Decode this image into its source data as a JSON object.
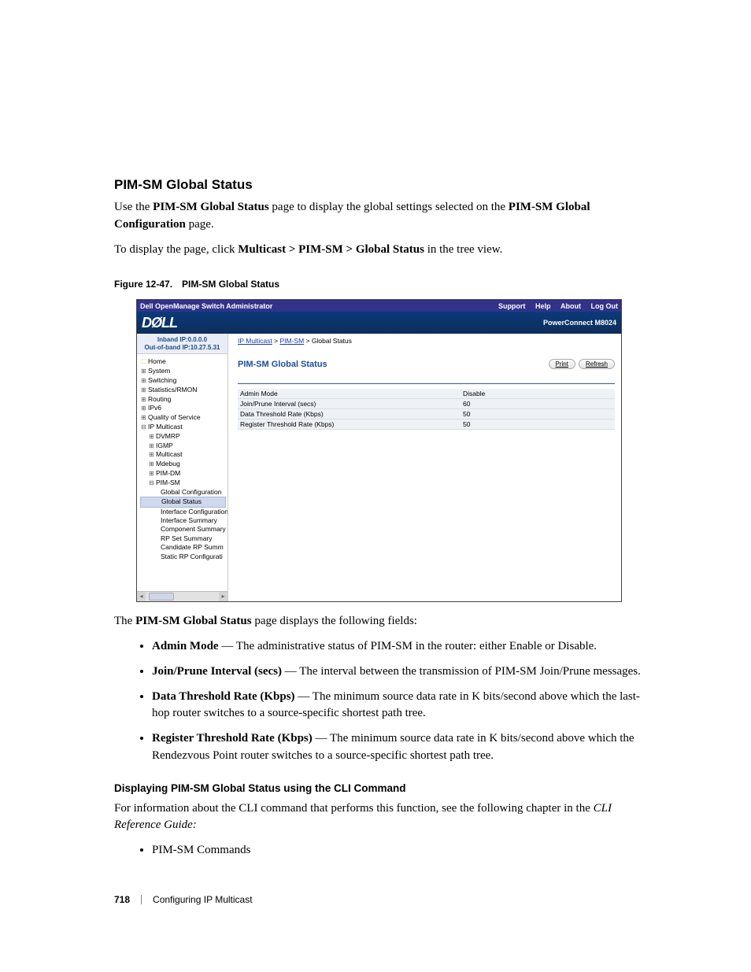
{
  "heading": "PIM-SM Global Status",
  "intro1_a": "Use the ",
  "intro1_b": "PIM-SM Global Status",
  "intro1_c": " page to display the global settings selected on the ",
  "intro1_d": "PIM-SM Global Configuration",
  "intro1_e": " page.",
  "intro2_a": "To display the page, click ",
  "intro2_b": "Multicast > PIM-SM > Global Status",
  "intro2_c": " in the tree view.",
  "figure_no": "Figure 12-47.",
  "figure_title": "PIM-SM Global Status",
  "screenshot": {
    "app_title": "Dell OpenManage Switch Administrator",
    "nav": {
      "support": "Support",
      "help": "Help",
      "about": "About",
      "logout": "Log Out"
    },
    "logo_text": "DØLL",
    "model": "PowerConnect M8024",
    "ipbox_a": "Inband IP:0.0.0.0",
    "ipbox_b": "Out-of-band IP:10.27.5.31",
    "tree": {
      "home": "Home",
      "system": "System",
      "switching": "Switching",
      "stats": "Statistics/RMON",
      "routing": "Routing",
      "ipv6": "IPv6",
      "qos": "Quality of Service",
      "ipmcast": "IP Multicast",
      "dvmrp": "DVMRP",
      "igmp": "IGMP",
      "multicast": "Multicast",
      "mdebug": "Mdebug",
      "pimdm": "PIM-DM",
      "pimsm": "PIM-SM",
      "gconf": "Global Configuration",
      "gstatus": "Global Status",
      "ifconf": "Interface Configuration",
      "ifsum": "Interface Summary",
      "compsum": "Component Summary",
      "rpset": "RP Set Summary",
      "candrp": "Candidate RP Summ",
      "staticrp": "Static RP Configurati"
    },
    "breadcrumb": {
      "a": "IP Multicast",
      "b": "PIM-SM",
      "c": "Global Status"
    },
    "panel_title": "PIM-SM Global Status",
    "buttons": {
      "print": "Print",
      "refresh": "Refresh"
    },
    "rows": [
      {
        "label": "Admin Mode",
        "value": "Disable"
      },
      {
        "label": "Join/Prune Interval (secs)",
        "value": "60"
      },
      {
        "label": "Data Threshold Rate (Kbps)",
        "value": "50"
      },
      {
        "label": "Register Threshold Rate (Kbps)",
        "value": "50"
      }
    ]
  },
  "postfig_a": "The ",
  "postfig_b": "PIM-SM Global Status",
  "postfig_c": " page displays the following fields:",
  "bullets": [
    {
      "term": "Admin Mode",
      "desc": " — The administrative status of PIM-SM in the router: either Enable or Disable."
    },
    {
      "term": "Join/Prune Interval (secs)",
      "desc": " — The interval between the transmission of PIM-SM Join/Prune messages."
    },
    {
      "term": "Data Threshold Rate (Kbps)",
      "desc": " — The minimum source data rate in K bits/second above which the last-hop router switches to a source-specific shortest path tree."
    },
    {
      "term": "Register Threshold Rate (Kbps)",
      "desc": " — The minimum source data rate in K bits/second above which the Rendezvous Point router switches to a source-specific shortest path tree."
    }
  ],
  "subhead": "Displaying PIM-SM Global Status using the CLI Command",
  "cli_text": "For information about the CLI command that performs this function, see the following chapter in the ",
  "cli_ref": "CLI Reference Guide:",
  "cli_bullet": "PIM-SM Commands",
  "footer": {
    "pageno": "718",
    "chapter": "Configuring IP Multicast"
  }
}
